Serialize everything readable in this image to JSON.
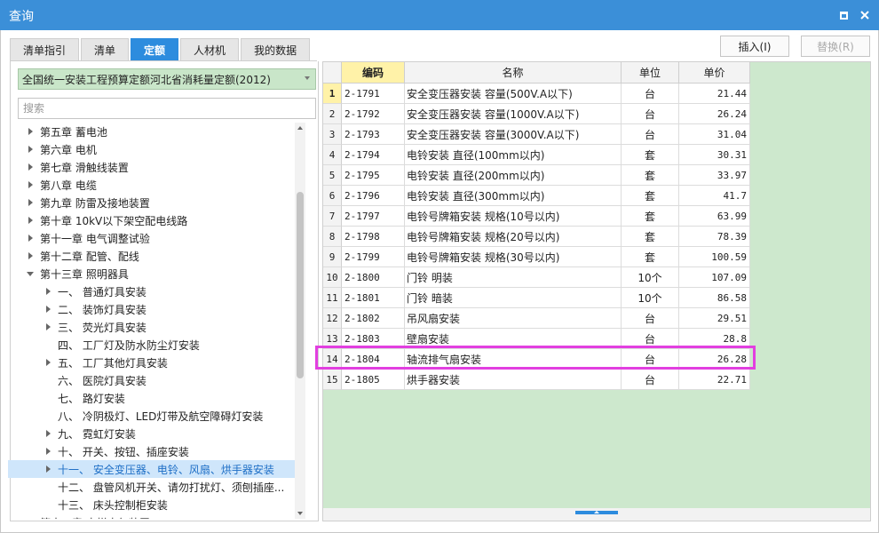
{
  "window": {
    "title": "查询"
  },
  "tabs": [
    {
      "label": "清单指引"
    },
    {
      "label": "清单"
    },
    {
      "label": "定额",
      "active": true
    },
    {
      "label": "人材机"
    },
    {
      "label": "我的数据"
    }
  ],
  "toolbar": {
    "insert_label": "插入(I)",
    "replace_label": "替换(R)"
  },
  "left": {
    "quota_library": "全国统一安装工程预算定额河北省消耗量定额(2012)",
    "search_placeholder": "搜索",
    "tree": [
      {
        "label": "第五章 蓄电池",
        "level": 0,
        "arrow": "right"
      },
      {
        "label": "第六章 电机",
        "level": 0,
        "arrow": "right"
      },
      {
        "label": "第七章 滑触线装置",
        "level": 0,
        "arrow": "right"
      },
      {
        "label": "第八章 电缆",
        "level": 0,
        "arrow": "right"
      },
      {
        "label": "第九章 防雷及接地装置",
        "level": 0,
        "arrow": "right"
      },
      {
        "label": "第十章 10kV以下架空配电线路",
        "level": 0,
        "arrow": "right"
      },
      {
        "label": "第十一章 电气调整试验",
        "level": 0,
        "arrow": "right"
      },
      {
        "label": "第十二章 配管、配线",
        "level": 0,
        "arrow": "right"
      },
      {
        "label": "第十三章 照明器具",
        "level": 0,
        "arrow": "down"
      },
      {
        "label": "一、 普通灯具安装",
        "level": 1,
        "arrow": "right"
      },
      {
        "label": "二、 装饰灯具安装",
        "level": 1,
        "arrow": "right"
      },
      {
        "label": "三、 荧光灯具安装",
        "level": 1,
        "arrow": "right"
      },
      {
        "label": "四、 工厂灯及防水防尘灯安装",
        "level": 1,
        "arrow": "none"
      },
      {
        "label": "五、 工厂其他灯具安装",
        "level": 1,
        "arrow": "right"
      },
      {
        "label": "六、 医院灯具安装",
        "level": 1,
        "arrow": "none"
      },
      {
        "label": "七、 路灯安装",
        "level": 1,
        "arrow": "none"
      },
      {
        "label": "八、 冷阴极灯、LED灯带及航空障碍灯安装",
        "level": 1,
        "arrow": "none"
      },
      {
        "label": "九、 霓虹灯安装",
        "level": 1,
        "arrow": "right"
      },
      {
        "label": "十、 开关、按钮、插座安装",
        "level": 1,
        "arrow": "right"
      },
      {
        "label": "十一、 安全变压器、电铃、风扇、烘手器安装",
        "level": 1,
        "arrow": "right",
        "selected": true
      },
      {
        "label": "十二、 盘管风机开关、请勿打扰灯、须刨插座...",
        "level": 1,
        "arrow": "none"
      },
      {
        "label": "十三、 床头控制柜安装",
        "level": 1,
        "arrow": "none"
      },
      {
        "label": "第十四章 电梯电气装置",
        "level": 0,
        "arrow": "right"
      }
    ]
  },
  "grid": {
    "columns": [
      "编码",
      "名称",
      "单位",
      "单价"
    ],
    "rows": [
      {
        "num": "1",
        "code": "2-1791",
        "name": "安全变压器安装 容量(500V.A以下)",
        "unit": "台",
        "price": "21.44"
      },
      {
        "num": "2",
        "code": "2-1792",
        "name": "安全变压器安装 容量(1000V.A以下)",
        "unit": "台",
        "price": "26.24"
      },
      {
        "num": "3",
        "code": "2-1793",
        "name": "安全变压器安装 容量(3000V.A以下)",
        "unit": "台",
        "price": "31.04"
      },
      {
        "num": "4",
        "code": "2-1794",
        "name": "电铃安装 直径(100mm以内)",
        "unit": "套",
        "price": "30.31"
      },
      {
        "num": "5",
        "code": "2-1795",
        "name": "电铃安装 直径(200mm以内)",
        "unit": "套",
        "price": "33.97"
      },
      {
        "num": "6",
        "code": "2-1796",
        "name": "电铃安装 直径(300mm以内)",
        "unit": "套",
        "price": "41.7"
      },
      {
        "num": "7",
        "code": "2-1797",
        "name": "电铃号牌箱安装 规格(10号以内)",
        "unit": "套",
        "price": "63.99"
      },
      {
        "num": "8",
        "code": "2-1798",
        "name": "电铃号牌箱安装 规格(20号以内)",
        "unit": "套",
        "price": "78.39"
      },
      {
        "num": "9",
        "code": "2-1799",
        "name": "电铃号牌箱安装 规格(30号以内)",
        "unit": "套",
        "price": "100.59"
      },
      {
        "num": "10",
        "code": "2-1800",
        "name": "门铃 明装",
        "unit": "10个",
        "price": "107.09"
      },
      {
        "num": "11",
        "code": "2-1801",
        "name": "门铃 暗装",
        "unit": "10个",
        "price": "86.58"
      },
      {
        "num": "12",
        "code": "2-1802",
        "name": "吊风扇安装",
        "unit": "台",
        "price": "29.51"
      },
      {
        "num": "13",
        "code": "2-1803",
        "name": "壁扇安装",
        "unit": "台",
        "price": "28.8"
      },
      {
        "num": "14",
        "code": "2-1804",
        "name": "轴流排气扇安装",
        "unit": "台",
        "price": "26.28"
      },
      {
        "num": "15",
        "code": "2-1805",
        "name": "烘手器安装",
        "unit": "台",
        "price": "22.71"
      }
    ]
  },
  "colors": {
    "accent": "#2d8cde",
    "titlebar": "#3b8fd8",
    "highlight": "#e23fe0",
    "grid_bg": "#cde8cd",
    "header_highlight": "#fff2a8"
  }
}
